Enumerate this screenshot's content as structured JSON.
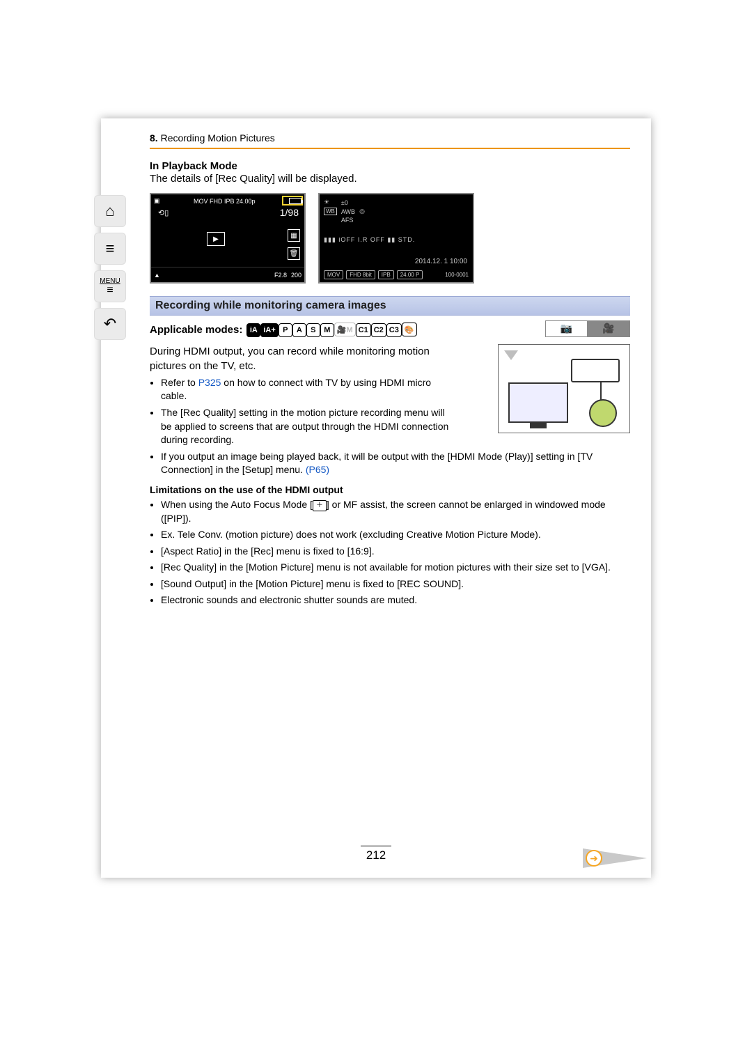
{
  "sidebar": {
    "home_icon": "⌂",
    "toc_icon": "≡",
    "menu_label": "MENU",
    "back_icon": "↶"
  },
  "chapter": {
    "number": "8.",
    "title": "Recording Motion Pictures"
  },
  "playback": {
    "heading": "In Playback Mode",
    "desc": "The details of [Rec Quality] will be displayed."
  },
  "shot_a": {
    "topbar": "MOV  FHD  IPB  24.00p",
    "counter": "1/98",
    "play_glyph": "▶",
    "bottom_left": "▲",
    "bottom_mid": "F2.8",
    "bottom_right": "200"
  },
  "shot_b": {
    "ev_icon": "☀",
    "ev": "±0",
    "wb_label": "WB",
    "wb_val": "AWB",
    "meter_icon": "◎",
    "afs": "AFS",
    "mid_icons": "▮▮▮ iOFF  I.R OFF  ▮▮ STD.",
    "date": "2014.12. 1 10:00",
    "chips": [
      "MOV",
      "FHD 8bit",
      "IPB",
      "24.00 P"
    ],
    "fileno": "100-0001"
  },
  "section_title": "Recording while monitoring camera images",
  "modes_label": "Applicable modes:",
  "modes": [
    "iA",
    "iA+",
    "P",
    "A",
    "S",
    "M",
    "🎥M",
    "C1",
    "C2",
    "C3",
    "🎨"
  ],
  "modes_filled": [
    0,
    1
  ],
  "modes_dim": [
    6
  ],
  "tabs": {
    "photo_icon": "📷",
    "video_icon": "🎥"
  },
  "intro": "During HDMI output, you can record while monitoring motion pictures on the TV, etc.",
  "bullets1": [
    {
      "pre": "Refer to ",
      "link": "P325",
      "post": " on how to connect with TV by using HDMI micro cable."
    },
    {
      "text": "The [Rec Quality] setting in the motion picture recording menu will be applied to screens that are output through the HDMI connection during recording."
    },
    {
      "pre": "If you output an image being played back, it will be output with the [HDMI Mode (Play)] setting in [TV Connection] in the [Setup] menu. ",
      "link": "(P65)",
      "post": ""
    }
  ],
  "limits_heading": "Limitations on the use of the HDMI output",
  "bullets2": [
    {
      "pre": "When using the Auto Focus Mode [",
      "icon": "＋",
      "post": "] or MF assist, the screen cannot be enlarged in windowed mode ([PIP])."
    },
    {
      "text": "Ex. Tele Conv. (motion picture) does not work (excluding Creative Motion Picture Mode)."
    },
    {
      "text": "[Aspect Ratio] in the [Rec] menu is fixed to [16:9]."
    },
    {
      "text": "[Rec Quality] in the [Motion Picture] menu is not available for motion pictures with their size set to [VGA]."
    },
    {
      "text": "[Sound Output] in the [Motion Picture] menu is fixed to [REC SOUND]."
    },
    {
      "text": "Electronic sounds and electronic shutter sounds are muted."
    }
  ],
  "page_number": "212",
  "next_glyph": "➜"
}
